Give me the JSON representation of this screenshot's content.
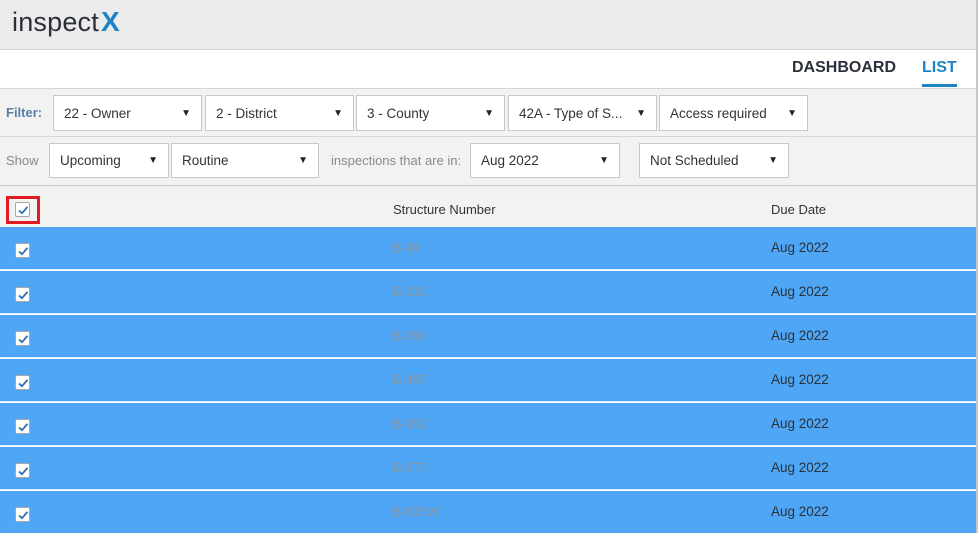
{
  "header": {
    "logo_text": "inspect",
    "logo_mark": "X",
    "brand_color": "#1c84c6"
  },
  "nav": {
    "tabs": [
      {
        "label": "DASHBOARD",
        "active": false
      },
      {
        "label": "LIST",
        "active": true
      }
    ]
  },
  "filters": {
    "label": "Filter:",
    "selects": [
      {
        "value": "22 - Owner"
      },
      {
        "value": "2 - District"
      },
      {
        "value": "3 - County"
      },
      {
        "value": "42A - Type of S..."
      },
      {
        "value": "Access required"
      }
    ]
  },
  "show_bar": {
    "label": "Show",
    "status_value": "Upcoming",
    "type_value": "Routine",
    "middle_text": "inspections that are in:",
    "period_value": "Aug 2022",
    "schedule_value": "Not Scheduled"
  },
  "table": {
    "select_all_checked": true,
    "columns": [
      "Structure Number",
      "Due Date"
    ],
    "row_color": "#4ea6f5",
    "rows": [
      {
        "checked": true,
        "structure": "B 49",
        "due": "Aug 2022"
      },
      {
        "checked": true,
        "structure": "B 232",
        "due": "Aug 2022"
      },
      {
        "checked": true,
        "structure": "B 390",
        "due": "Aug 2022"
      },
      {
        "checked": true,
        "structure": "B 487",
        "due": "Aug 2022"
      },
      {
        "checked": true,
        "structure": "B 452",
        "due": "Aug 2022"
      },
      {
        "checked": true,
        "structure": "B 577",
        "due": "Aug 2022"
      },
      {
        "checked": true,
        "structure": "B 835W",
        "due": "Aug 2022"
      }
    ]
  },
  "highlight_color": "#e11b22",
  "icons": {
    "dropdown": "caret-down-icon",
    "checkbox": "checkmark-icon"
  }
}
